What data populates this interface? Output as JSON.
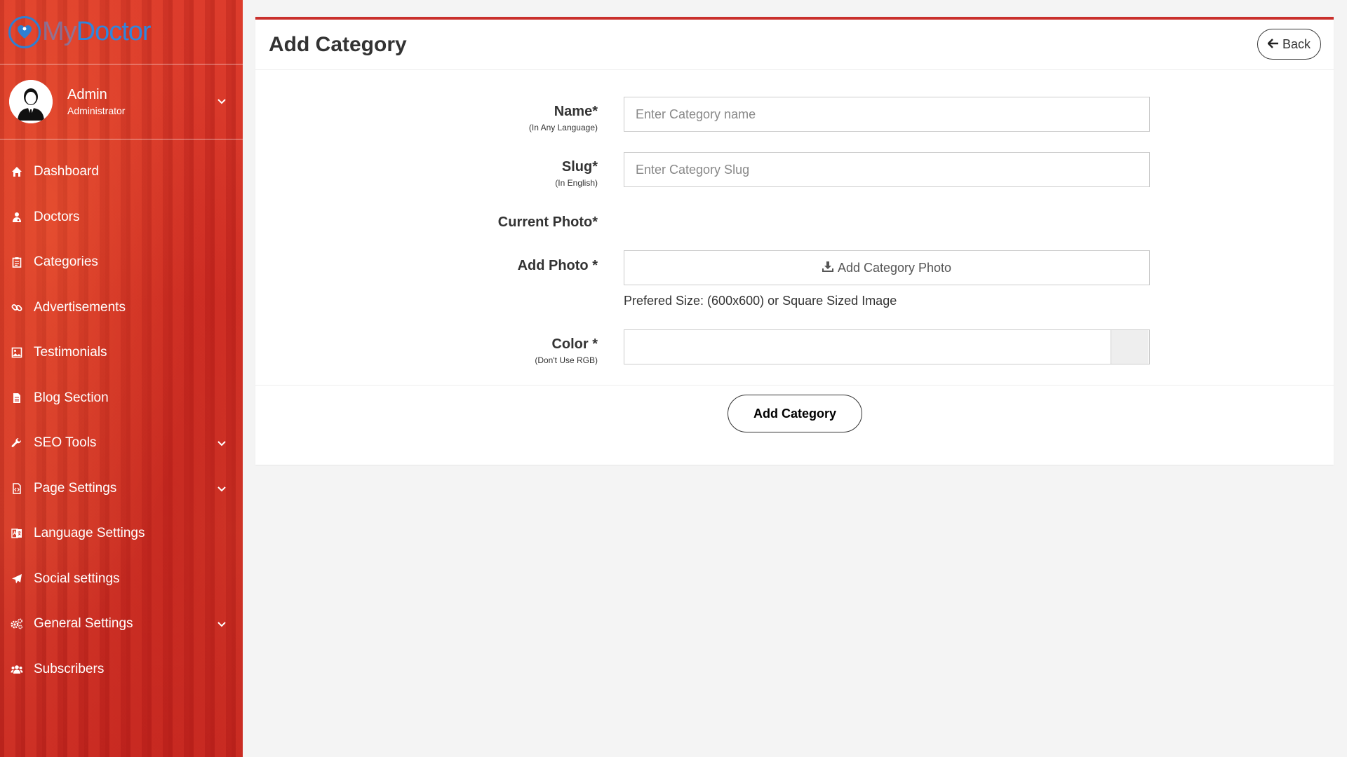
{
  "brand": {
    "name_part1": "My",
    "name_part2": "Doctor",
    "accent": "#2f86de"
  },
  "user": {
    "name": "Admin",
    "role": "Administrator"
  },
  "sidebar": {
    "items": [
      {
        "label": "Dashboard",
        "icon": "home-icon",
        "has_submenu": false
      },
      {
        "label": "Doctors",
        "icon": "user-md-icon",
        "has_submenu": false
      },
      {
        "label": "Categories",
        "icon": "clipboard-icon",
        "has_submenu": false
      },
      {
        "label": "Advertisements",
        "icon": "link-icon",
        "has_submenu": false
      },
      {
        "label": "Testimonials",
        "icon": "image-icon",
        "has_submenu": false
      },
      {
        "label": "Blog Section",
        "icon": "file-icon",
        "has_submenu": false
      },
      {
        "label": "SEO Tools",
        "icon": "wrench-icon",
        "has_submenu": true
      },
      {
        "label": "Page Settings",
        "icon": "file-code-icon",
        "has_submenu": true
      },
      {
        "label": "Language Settings",
        "icon": "language-icon",
        "has_submenu": false
      },
      {
        "label": "Social settings",
        "icon": "paper-plane-icon",
        "has_submenu": false
      },
      {
        "label": "General Settings",
        "icon": "cogs-icon",
        "has_submenu": true
      },
      {
        "label": "Subscribers",
        "icon": "users-icon",
        "has_submenu": false
      }
    ]
  },
  "page": {
    "title": "Add Category",
    "back_label": "Back",
    "accent": "#c9302c"
  },
  "form": {
    "name": {
      "label": "Name*",
      "sublabel": "(In Any Language)",
      "placeholder": "Enter Category name",
      "value": ""
    },
    "slug": {
      "label": "Slug*",
      "sublabel": "(In English)",
      "placeholder": "Enter Category Slug",
      "value": ""
    },
    "current_photo": {
      "label": "Current Photo*"
    },
    "add_photo": {
      "label": "Add Photo *",
      "button_label": "Add Category Photo",
      "help": "Prefered Size: (600x600) or Square Sized Image"
    },
    "color": {
      "label": "Color *",
      "sublabel": "(Don't Use RGB)",
      "value": ""
    },
    "submit_label": "Add Category"
  }
}
